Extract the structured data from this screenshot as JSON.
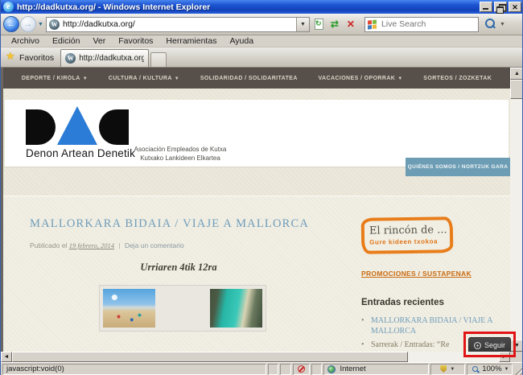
{
  "colors": {
    "titlebar_blue": "#1d55d2",
    "site_nav_brown": "#57504a",
    "accent_orange": "#e87d1a",
    "steel_blue": "#6f9cba",
    "about_button_blue": "#6d9db4",
    "follow_gray": "#3c3c3c",
    "annotation_red": "#e01414"
  },
  "window": {
    "title": "http://dadkutxa.org/ - Windows Internet Explorer"
  },
  "toolbar": {
    "address": "http://dadkutxa.org/",
    "search_placeholder": "Live Search"
  },
  "menubar": {
    "items": [
      "Archivo",
      "Edición",
      "Ver",
      "Favoritos",
      "Herramientas",
      "Ayuda"
    ]
  },
  "tabbar": {
    "favorites_label": "Favoritos",
    "tab_title": "http://dadkutxa.org/"
  },
  "site": {
    "nav_items": [
      {
        "label": "DEPORTE / KIROLA",
        "has_dropdown": true
      },
      {
        "label": "CULTURA / KULTURA",
        "has_dropdown": true
      },
      {
        "label": "SOLIDARIDAD / SOLIDARITATEA",
        "has_dropdown": false
      },
      {
        "label": "VACACIONES / OPORRAK",
        "has_dropdown": true
      },
      {
        "label": "SORTEOS / ZOZKETAK",
        "has_dropdown": false
      }
    ],
    "logo_caption": "Denon Artean Denetik",
    "taglines": [
      "Asociación Empleados de Kutxa",
      "Kutxako Lankideen Elkartea"
    ],
    "about_button": "QUIÉNES SOMOS / NORTZUK GARA",
    "article": {
      "title": "MALLORKARA BIDAIA / VIAJE A MALLORCA",
      "published_prefix": "Publicado el",
      "date": "19 febrero, 2014",
      "separator": "|",
      "comment_link": "Deja un comentario",
      "subtitle": "Urriaren 4tik 12ra"
    },
    "sidebar": {
      "badge_title": "El rincón de ...",
      "badge_subtitle": "Gure kideen txokoa",
      "promo_link": "PROMOCIONES / SUSTAPENAK",
      "recent_title": "Entradas recientes",
      "recent_items": [
        "MALLORKARA BIDAIA / VIAJE A MALLORCA",
        "Sarrerak / Entradas: “Re"
      ]
    },
    "follow_button": "Seguir"
  },
  "statusbar": {
    "left_text": "javascript:void(0)",
    "zone_label": "Internet",
    "zoom_level": "100%"
  }
}
